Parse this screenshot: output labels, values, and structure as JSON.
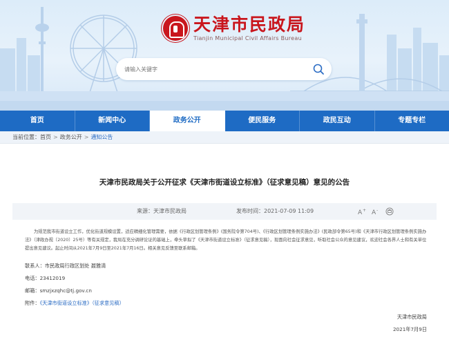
{
  "header": {
    "site_name": "天津市民政局",
    "site_name_en": "Tianjin Municipal Civil Affairs Bureau"
  },
  "search": {
    "placeholder": "请输入关键字"
  },
  "nav": {
    "items": [
      {
        "label": "首页"
      },
      {
        "label": "新闻中心"
      },
      {
        "label": "政务公开"
      },
      {
        "label": "便民服务"
      },
      {
        "label": "政民互动"
      },
      {
        "label": "专题专栏"
      }
    ],
    "active_index": 2
  },
  "breadcrumb": {
    "prefix": "当前位置：",
    "items": [
      "首页",
      "政务公开",
      "通知公告"
    ],
    "separator": ">"
  },
  "article": {
    "title": "天津市民政局关于公开征求《天津市街道设立标准》（征求意见稿）意见的公告",
    "source": "来源：天津市民政局",
    "publish_time": "发布时间：2021-07-09 11:09",
    "tools": {
      "font_up": "A+",
      "font_down": "A-",
      "print": "print"
    },
    "body": "为规范我市街道设立工作，优化街道规模设置，适应精细化管理需要，依据《行政区划管理条例》(国务院令第704号)、《行政区划管理条例实施办法》(民政部令第65号)和《天津市行政区划管理条例实施办法》（津政办规〔2020〕25号）等有关规定，我局在充分调研论证的基础上，牵头草拟了《天津市街道设立标准》（征求意见稿），现面向社会征求意见，听取社会公众的意见建议，欢迎社会各界人士和有关单位提出意见建议。起止时间从2021年7月9日至2021年7月16日。相关意见反馈至联系邮箱。",
    "contact": "联系人：市民政局行政区划处  聂雅清",
    "phone": "电话：23412019",
    "email": "邮箱：smzjxzqhc@tj.gov.cn",
    "attachment_label": "附件：",
    "attachment_file": "《天津市街道设立标准》（征求意见稿）",
    "sign_org": "天津市民政局",
    "sign_date": "2021年7月9日"
  },
  "colors": {
    "brand_red": "#c9161d",
    "nav_blue": "#1e6bc4",
    "link_blue": "#2b6cc4"
  }
}
